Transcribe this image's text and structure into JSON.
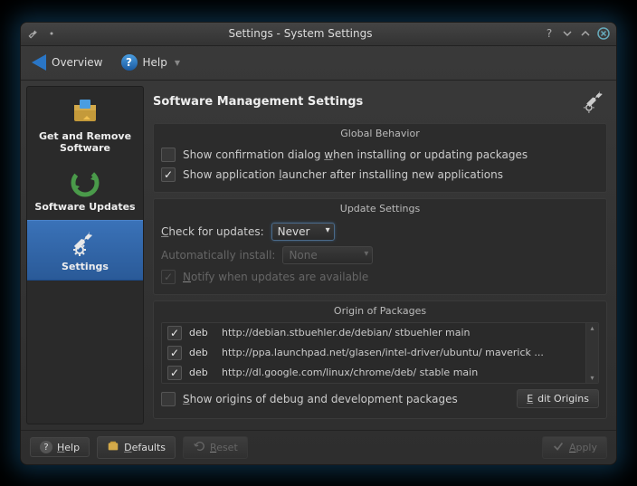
{
  "window": {
    "title": "Settings - System Settings"
  },
  "toolbar": {
    "overview": "Overview",
    "help": "Help"
  },
  "sidebar": {
    "items": [
      {
        "label": "Get and Remove Software"
      },
      {
        "label": "Software Updates"
      },
      {
        "label": "Settings"
      }
    ]
  },
  "content": {
    "title": "Software Management Settings",
    "global": {
      "legend": "Global Behavior",
      "confirm": "Show confirmation dialog when installing or updating packages",
      "launcher": "Show application launcher after installing new applications"
    },
    "updates": {
      "legend": "Update Settings",
      "check_label": "Check for updates:",
      "check_value": "Never",
      "auto_label": "Automatically install:",
      "auto_value": "None",
      "notify": "Notify when updates are available"
    },
    "origins": {
      "legend": "Origin of Packages",
      "rows": [
        {
          "type": "deb",
          "url": "http://debian.stbuehler.de/debian/ stbuehler main"
        },
        {
          "type": "deb",
          "url": "http://ppa.launchpad.net/glasen/intel-driver/ubuntu/ maverick ..."
        },
        {
          "type": "deb",
          "url": "http://dl.google.com/linux/chrome/deb/ stable main"
        }
      ],
      "show_debug": "Show origins of debug and development packages",
      "edit": "Edit Origins"
    }
  },
  "footer": {
    "help": "Help",
    "defaults": "Defaults",
    "reset": "Reset",
    "apply": "Apply"
  }
}
